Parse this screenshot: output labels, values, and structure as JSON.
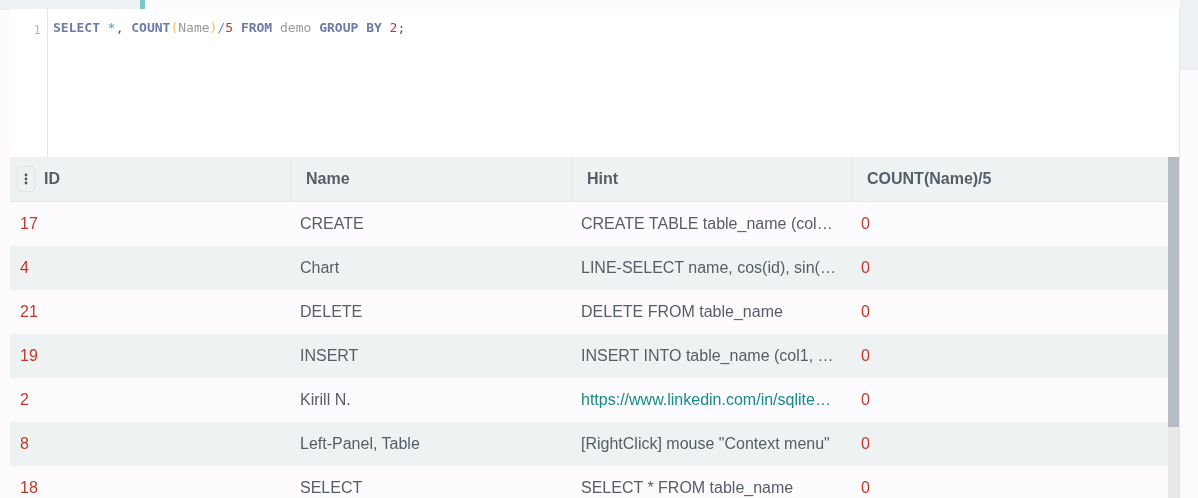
{
  "editor": {
    "line_number": "1",
    "words": [
      [
        {
          "kind": "keyword",
          "text": "SELECT"
        }
      ],
      [
        {
          "kind": "operator",
          "text": "*"
        },
        {
          "kind": "punct",
          "text": ","
        }
      ],
      [
        {
          "kind": "keyword",
          "text": "COUNT"
        },
        {
          "kind": "paren",
          "text": "("
        },
        {
          "kind": "identifier",
          "text": "Name"
        },
        {
          "kind": "paren",
          "text": ")"
        },
        {
          "kind": "operator",
          "text": "/"
        },
        {
          "kind": "number",
          "text": "5"
        }
      ],
      [
        {
          "kind": "keyword",
          "text": "FROM"
        }
      ],
      [
        {
          "kind": "identifier",
          "text": "demo"
        }
      ],
      [
        {
          "kind": "keyword",
          "text": "GROUP"
        }
      ],
      [
        {
          "kind": "keyword",
          "text": "BY"
        }
      ],
      [
        {
          "kind": "number",
          "text": "2"
        },
        {
          "kind": "punct",
          "text": ";"
        }
      ]
    ]
  },
  "table": {
    "columns": [
      "ID",
      "Name",
      "Hint",
      "COUNT(Name)/5"
    ],
    "rows": [
      {
        "kind": "text",
        "cells": [
          "17",
          "CREATE",
          "CREATE TABLE table_name (col…",
          "0"
        ]
      },
      {
        "kind": "text",
        "cells": [
          "4",
          "Chart",
          "LINE-SELECT name, cos(id), sin(…",
          "0"
        ]
      },
      {
        "kind": "text",
        "cells": [
          "21",
          "DELETE",
          "DELETE FROM table_name",
          "0"
        ]
      },
      {
        "kind": "text",
        "cells": [
          "19",
          "INSERT",
          "INSERT INTO table_name (col1, …",
          "0"
        ]
      },
      {
        "kind": "link",
        "cells": [
          "2",
          "Kirill N.",
          "https://www.linkedin.com/in/sqlite…",
          "0"
        ]
      },
      {
        "kind": "text",
        "cells": [
          "8",
          "Left-Panel, Table",
          "[RightClick] mouse \"Context menu\"",
          "0"
        ]
      },
      {
        "kind": "text",
        "cells": [
          "18",
          "SELECT",
          "SELECT * FROM table_name",
          "0"
        ]
      }
    ]
  }
}
